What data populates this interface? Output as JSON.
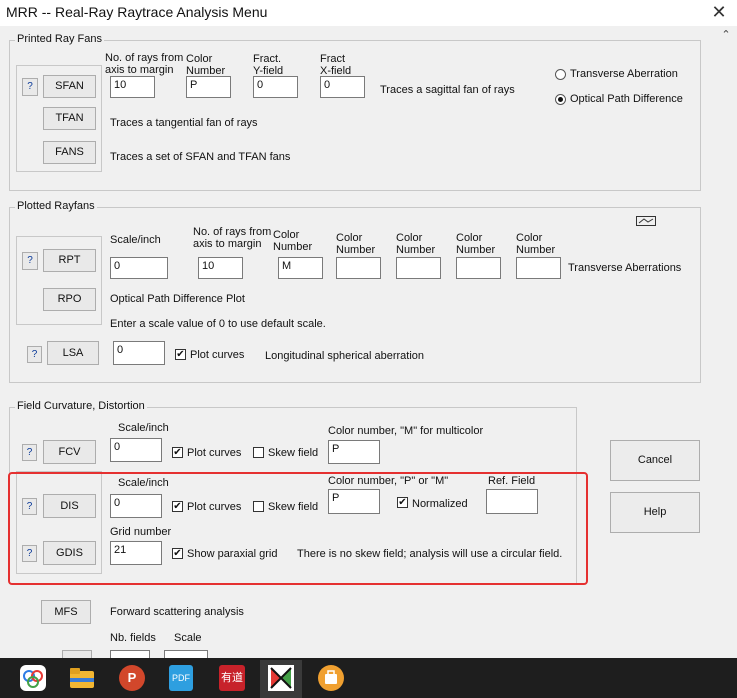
{
  "window": {
    "title": "MRR -- Real-Ray Raytrace Analysis Menu",
    "close_glyph": "✕",
    "scroll_up_glyph": "⌃"
  },
  "printed": {
    "group_label": "Printed Ray Fans",
    "hdr_rays": "No. of rays from\naxis to margin",
    "hdr_color": "Color\nNumber",
    "hdr_y": "Fract.\nY-field",
    "hdr_x": "Fract\nX-field",
    "q": "?",
    "sfan": {
      "label": "SFAN",
      "rays": "10",
      "color": "P",
      "y": "0",
      "x": "0",
      "desc": "Traces a sagittal  fan of rays"
    },
    "tfan": {
      "label": "TFAN",
      "desc": "Traces a tangential fan of rays"
    },
    "fans": {
      "label": "FANS",
      "desc": "Traces a set of SFAN and TFAN fans"
    },
    "radio_transverse": "Transverse Aberration",
    "radio_opd": "Optical Path Difference",
    "selected_radio": "opd"
  },
  "plotted": {
    "group_label": "Plotted Rayfans",
    "hdr_scale": "Scale/inch",
    "hdr_rays": "No. of rays from\naxis to margin",
    "hdr_color": "Color\nNumber",
    "q": "?",
    "rpt": {
      "label": "RPT",
      "scale": "0",
      "rays": "10",
      "colors": [
        "M",
        "",
        "",
        "",
        ""
      ],
      "trailing": "Transverse Aberrations"
    },
    "rpo": {
      "label": "RPO",
      "desc": "Optical Path Difference Plot"
    },
    "note": "Enter a scale value of 0 to use default scale.",
    "lsa": {
      "label": "LSA",
      "value": "0",
      "plot_label": "Plot curves",
      "plot_checked": "✔",
      "desc": "Longitudinal spherical aberration"
    }
  },
  "field": {
    "group_label": "Field Curvature, Distortion",
    "q": "?",
    "fcv": {
      "label": "FCV",
      "hdr_scale": "Scale/inch",
      "scale": "0",
      "plot_label": "Plot curves",
      "plot_checked": "✔",
      "skew_label": "Skew field",
      "color_hdr": "Color number, \"M\" for multicolor",
      "color": "P"
    },
    "dis": {
      "label": "DIS",
      "hdr_scale": "Scale/inch",
      "scale": "0",
      "plot_label": "Plot curves",
      "plot_checked": "✔",
      "skew_label": "Skew field",
      "color_hdr": "Color number, \"P\" or \"M\"",
      "color": "P",
      "normalized_label": "Normalized",
      "normalized_checked": "✔",
      "ref_hdr": "Ref. Field",
      "ref": ""
    },
    "gdis": {
      "label": "GDIS",
      "hdr_grid": "Grid number",
      "grid": "21",
      "show_label": "Show paraxial grid",
      "show_checked": "✔",
      "note": "There is no skew field; analysis will use a circular field."
    }
  },
  "mfs": {
    "label": "MFS",
    "desc": "Forward scattering analysis",
    "hdr_fields": "Nb. fields",
    "hdr_scale": "Scale"
  },
  "side": {
    "cancel": "Cancel",
    "help": "Help"
  },
  "taskbar": {
    "icons": [
      {
        "name": "app-icon",
        "color": "#ffffff"
      },
      {
        "name": "folder-icon",
        "color": "#f2b632"
      },
      {
        "name": "powerpoint-icon",
        "color": "#d2472b"
      },
      {
        "name": "pdf-icon",
        "color": "#2e9fe0"
      },
      {
        "name": "app-red-icon",
        "color": "#c7222a"
      },
      {
        "name": "optics-app-icon",
        "color": "#ffffff"
      },
      {
        "name": "briefcase-icon",
        "color": "#f0a030"
      }
    ],
    "pdf_text": "PDF",
    "red_text": "有道",
    "ppt_text": "P"
  },
  "icons": {
    "plot-thumbnail": "plot-icon"
  }
}
